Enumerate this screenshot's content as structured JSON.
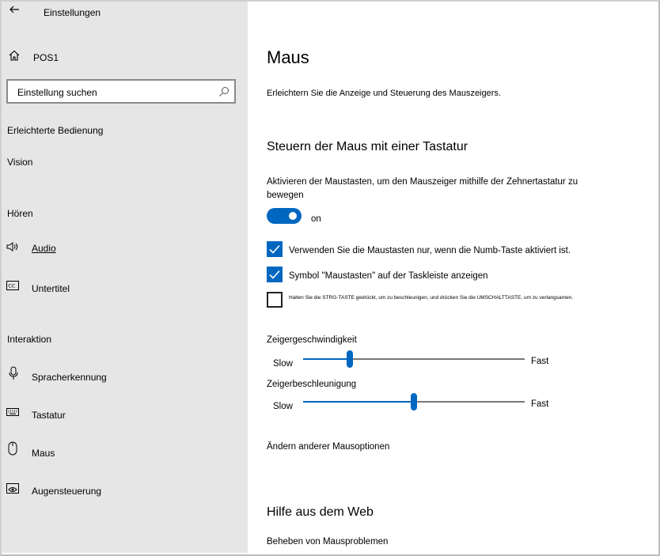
{
  "window": {
    "title": "Einstellungen"
  },
  "sidebar": {
    "home_label": "POS1",
    "search_placeholder": "Einstellung suchen",
    "category": "Erleichterte Bedienung",
    "sections": {
      "vision": "Vision",
      "hoeren": "Hören",
      "interaktion": "Interaktion"
    },
    "items": {
      "audio": {
        "label": "Audio",
        "icon": "speaker-icon"
      },
      "untertitel": {
        "label": "Untertitel",
        "icon": "captions-icon"
      },
      "sprache": {
        "label": "Spracherkennung",
        "icon": "microphone-icon"
      },
      "tastatur": {
        "label": "Tastatur",
        "icon": "keyboard-icon"
      },
      "maus": {
        "label": "Maus",
        "icon": "mouse-icon"
      },
      "augen": {
        "label": "Augensteuerung",
        "icon": "eye-control-icon"
      }
    }
  },
  "main": {
    "title": "Maus",
    "description": "Erleichtern Sie die Anzeige und Steuerung des Mauszeigers.",
    "section_heading": "Steuern der Maus mit einer Tastatur",
    "toggle": {
      "description": "Aktivieren der Maustasten, um den Mauszeiger mithilfe der Zehnertastatur zu bewegen",
      "state_label": "on",
      "on": true
    },
    "checkboxes": [
      {
        "label": "Verwenden Sie die Maustasten nur, wenn die Numb-Taste aktiviert ist.",
        "checked": true
      },
      {
        "label": "Symbol \"Maustasten\" auf der Taskleiste anzeigen",
        "checked": true
      },
      {
        "label": "Halten Sie die STRG-TASTE gedrückt, um zu beschleunigen, und drücken Sie die UMSCHALTTASTE, um zu verlangsamen.",
        "checked": false
      }
    ],
    "sliders": {
      "speed": {
        "label": "Zeigergeschwindigkeit",
        "min_label": "Slow",
        "max_label": "Fast",
        "value_fraction": 0.21
      },
      "accel": {
        "label": "Zeigerbeschleunigung",
        "min_label": "Slow",
        "max_label": "Fast",
        "value_fraction": 0.5
      }
    },
    "other_options_link": "Ändern anderer Mausoptionen",
    "help_heading": "Hilfe aus dem Web",
    "help_link": "Beheben von Mausproblemen"
  },
  "colors": {
    "accent": "#0067c0",
    "sidebar_bg": "#e6e6e6"
  }
}
